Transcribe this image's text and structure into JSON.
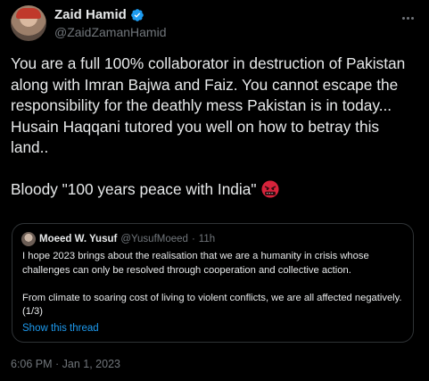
{
  "author": {
    "display_name": "Zaid Hamid",
    "handle": "@ZaidZamanHamid",
    "verified": true,
    "icons": {
      "verified": "verified-badge-icon",
      "more": "more-options-icon"
    }
  },
  "tweet": {
    "paragraphs": [
      "You are a full 100% collaborator in destruction of Pakistan along with Imran Bajwa and Faiz. You cannot escape the responsibility for the deathly mess Pakistan is in today...",
      "Husain Haqqani tutored you well on how to betray this land.."
    ],
    "closing_line": "Bloody \"100 years peace with India\"",
    "emoji": "angry-face-with-symbols-emoji",
    "timestamp": "6:06 PM · Jan 1, 2023"
  },
  "quoted_tweet": {
    "display_name": "Moeed W. Yusuf",
    "handle": "@YusufMoeed",
    "separator": "·",
    "time": "11h",
    "paragraphs": [
      "I hope 2023 brings about the realisation that we are a humanity in crisis whose challenges can only be resolved through cooperation and collective action.",
      "From climate to soaring cost of living to violent conflicts, we are all affected negatively. (1/3)"
    ],
    "show_thread_label": "Show this thread"
  },
  "colors": {
    "background": "#000000",
    "text": "#e7e9ea",
    "secondary": "#71767b",
    "accent": "#1d9bf0",
    "border": "#2f3336"
  }
}
